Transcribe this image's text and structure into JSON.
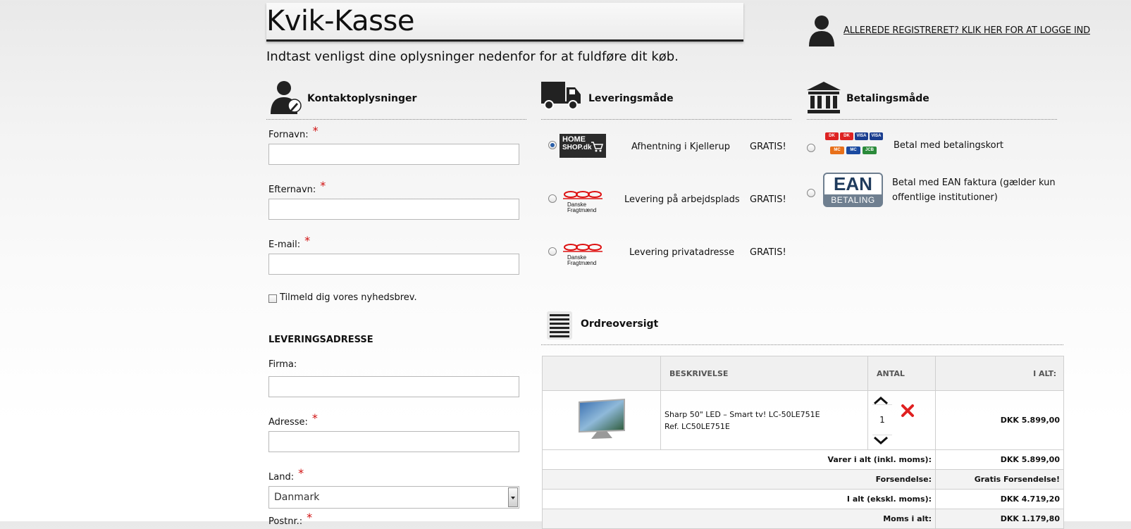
{
  "page": {
    "title": "Kvik-Kasse",
    "subtitle": "Indtast venligst dine oplysninger nedenfor for at fuldføre dit køb.",
    "login_link": "ALLEREDE REGISTRERET? KLIK HER FOR AT LOGGE IND"
  },
  "contact": {
    "heading": "Kontaktoplysninger",
    "fields": {
      "firstname": "Fornavn:",
      "lastname": "Efternavn:",
      "email": "E-mail:"
    },
    "required_mark": "*",
    "newsletter_label": "Tilmeld dig vores nyhedsbrev."
  },
  "delivery_address": {
    "heading": "LEVERINGSADRESSE",
    "company": "Firma:",
    "address": "Adresse:",
    "country": "Land:",
    "country_value": "Danmark",
    "zip": "Postnr.:"
  },
  "shipping": {
    "heading": "Leveringsmåde",
    "logos": {
      "homeshop_line1": "HOME",
      "homeshop_line2": "SHOP.dk",
      "df_line1": "Danske",
      "df_line2": "Fragtmænd"
    },
    "options": [
      {
        "label": "Afhentning i Kjellerup",
        "price": "GRATIS!",
        "selected": true
      },
      {
        "label": "Levering på arbejdsplads",
        "price": "GRATIS!",
        "selected": false
      },
      {
        "label": "Levering privatadresse",
        "price": "GRATIS!",
        "selected": false
      }
    ]
  },
  "payment": {
    "heading": "Betalingsmåde",
    "options": [
      {
        "label": "Betal med betalingskort"
      },
      {
        "label_line1": "Betal med EAN faktura (gælder kun",
        "label_line2": "offentlige institutioner)"
      }
    ],
    "ean_logo_top": "EAN",
    "ean_logo_bottom": "BETALING",
    "cards": [
      "DK",
      "DK",
      "VISA",
      "VISA",
      "MC",
      "MC",
      "JCB"
    ]
  },
  "order": {
    "heading": "Ordreoversigt",
    "columns": {
      "desc": "BESKRIVELSE",
      "qty": "ANTAL",
      "total": "I ALT:"
    },
    "item": {
      "name": "Sharp 50\" LED – Smart tv! LC-50LE751E",
      "ref": "Ref. LC50LE751E",
      "qty": "1",
      "price": "DKK 5.899,00"
    },
    "summary": [
      {
        "label": "Varer i alt (inkl. moms):",
        "value": "DKK 5.899,00"
      },
      {
        "label": "Forsendelse:",
        "value": "Gratis Forsendelse!"
      },
      {
        "label": "I alt (ekskl. moms):",
        "value": "DKK 4.719,20"
      },
      {
        "label": "Moms i alt:",
        "value": "DKK 1.179,80"
      }
    ]
  },
  "colors": {
    "required": "#d01010",
    "radio_selected": "#2a5fa8",
    "remove_icon": "#e02020"
  }
}
